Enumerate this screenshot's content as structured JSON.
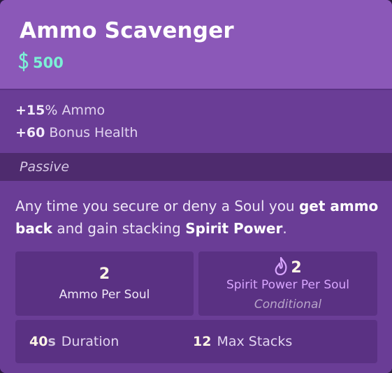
{
  "item": {
    "title": "Ammo Scavenger",
    "cost": "500",
    "cost_icon": "souls-currency-icon"
  },
  "stats": [
    {
      "sign": "+",
      "value": "15",
      "unit": "%",
      "label": "Ammo"
    },
    {
      "sign": "+",
      "value": "60",
      "unit": "",
      "label": "Bonus Health"
    }
  ],
  "passive": {
    "label": "Passive",
    "description": {
      "p1": "Any time you secure or deny a Soul you ",
      "b1": "get ammo back",
      "p2": " and gain stacking ",
      "b2": "Spirit Power",
      "p3": "."
    },
    "ammo_per_soul": {
      "value": "2",
      "label": "Ammo Per Soul"
    },
    "spirit_power_per_soul": {
      "value": "2",
      "label": "Spirit Power Per Soul",
      "condition": "Conditional",
      "icon": "spirit-flame-icon"
    },
    "duration": {
      "value": "40",
      "unit": "s",
      "label": "Duration"
    },
    "max_stacks": {
      "value": "12",
      "label": "Max Stacks"
    }
  },
  "colors": {
    "header": "#8b58b8",
    "body": "#6a3d96",
    "cost": "#7cf0d6",
    "spirit": "#d9a6ff"
  }
}
